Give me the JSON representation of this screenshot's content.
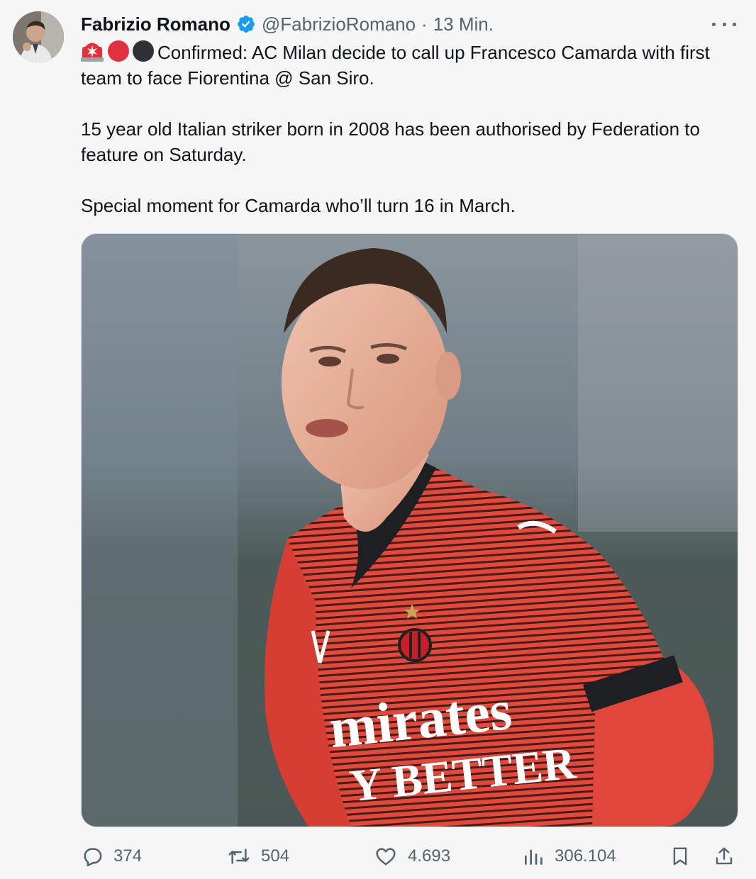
{
  "author": {
    "name": "Fabrizio Romano",
    "handle": "@FabrizioRomano",
    "separator": "·",
    "time": "13 Min."
  },
  "icons": {
    "verified": "verified-badge-icon",
    "more": "more-options-icon",
    "reply": "reply-icon",
    "retweet": "retweet-icon",
    "like": "heart-icon",
    "views": "views-icon",
    "bookmark": "bookmark-icon",
    "share": "share-icon"
  },
  "colors": {
    "verified": "#1d9bf0",
    "secondary_text": "#536471",
    "milan_red": "#d9263c",
    "milan_black": "#2b2f33"
  },
  "text": {
    "line1": "Confirmed: AC Milan decide to call up Francesco Camarda with first team to face Fiorentina @ San Siro.",
    "line2": "15 year old Italian striker born in 2008 has been authorised by Federation to feature on Saturday.",
    "line3": "Special moment for Camarda who’ll turn 16 in March."
  },
  "image": {
    "shirt_text_1": "mirates",
    "shirt_text_2": "Y BETTER"
  },
  "metrics": {
    "replies": "374",
    "retweets": "504",
    "likes": "4.693",
    "views": "306.104"
  }
}
